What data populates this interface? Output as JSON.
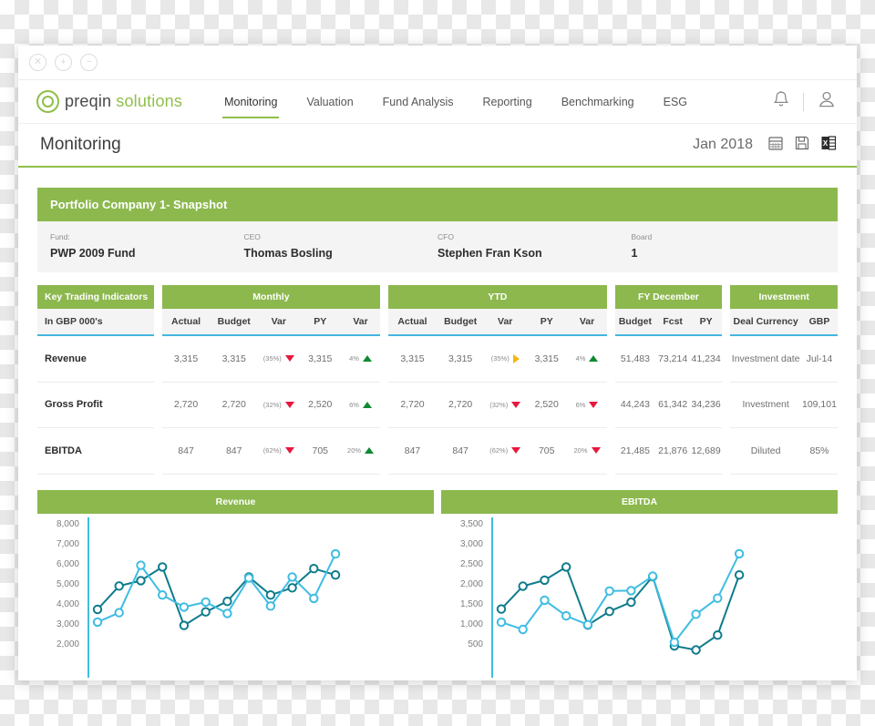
{
  "window": {
    "titlebar_buttons": [
      {
        "name": "close",
        "glyph": "×"
      },
      {
        "name": "maximize",
        "glyph": "+"
      },
      {
        "name": "minimize",
        "glyph": "−"
      }
    ]
  },
  "nav": {
    "brand_primary": "preqin",
    "brand_secondary": "solutions",
    "items": [
      {
        "label": "Monitoring",
        "active": true
      },
      {
        "label": "Valuation",
        "active": false
      },
      {
        "label": "Fund Analysis",
        "active": false
      },
      {
        "label": "Reporting",
        "active": false
      },
      {
        "label": "Benchmarking",
        "active": false
      },
      {
        "label": "ESG",
        "active": false
      }
    ],
    "notification_icon": "bell-icon",
    "account_icon": "user-icon"
  },
  "page_header": {
    "title": "Monitoring",
    "period": "Jan 2018",
    "actions": [
      "calendar-icon",
      "save-icon",
      "excel-export-icon"
    ]
  },
  "snapshot": {
    "title": "Portfolio Company 1- Snapshot",
    "fields": [
      {
        "label": "Fund:",
        "value": "PWP 2009 Fund"
      },
      {
        "label": "CEO",
        "value": "Thomas Bosling"
      },
      {
        "label": "CFO",
        "value": "Stephen Fran Kson"
      },
      {
        "label": "Board",
        "value": "1"
      }
    ]
  },
  "kti": {
    "groups": [
      {
        "head": "Key Trading Indicators",
        "subheads": [
          "In GBP 000's"
        ]
      },
      {
        "head": "Monthly",
        "subheads": [
          "Actual",
          "Budget",
          "Var",
          "PY",
          "Var"
        ]
      },
      {
        "head": "YTD",
        "subheads": [
          "Actual",
          "Budget",
          "Var",
          "PY",
          "Var"
        ]
      },
      {
        "head": "FY December",
        "subheads": [
          "Budget",
          "Fcst",
          "PY"
        ]
      },
      {
        "head": "Investment",
        "subheads": [
          "Deal Currency",
          "GBP"
        ]
      }
    ],
    "rows": [
      {
        "name": "Revenue",
        "monthly": {
          "actual": "3,315",
          "budget": "3,315",
          "var1_pct": "(35%)",
          "var1_dir": "down",
          "py": "3,315",
          "var2_pct": "4%",
          "var2_dir": "up"
        },
        "ytd": {
          "actual": "3,315",
          "budget": "3,315",
          "var1_pct": "(35%)",
          "var1_dir": "flat",
          "py": "3,315",
          "var2_pct": "4%",
          "var2_dir": "up"
        },
        "fy": {
          "budget": "51,483",
          "fcst": "73,214",
          "py": "41,234"
        },
        "investment": {
          "label": "Investment date",
          "value": "Jul-14"
        }
      },
      {
        "name": "Gross Profit",
        "monthly": {
          "actual": "2,720",
          "budget": "2,720",
          "var1_pct": "(32%)",
          "var1_dir": "down",
          "py": "2,520",
          "var2_pct": "6%",
          "var2_dir": "up"
        },
        "ytd": {
          "actual": "2,720",
          "budget": "2,720",
          "var1_pct": "(32%)",
          "var1_dir": "down",
          "py": "2,520",
          "var2_pct": "6%",
          "var2_dir": "down"
        },
        "fy": {
          "budget": "44,243",
          "fcst": "61,342",
          "py": "34,236"
        },
        "investment": {
          "label": "Investment",
          "value": "109,101"
        }
      },
      {
        "name": "EBITDA",
        "monthly": {
          "actual": "847",
          "budget": "847",
          "var1_pct": "(62%)",
          "var1_dir": "down",
          "py": "705",
          "var2_pct": "20%",
          "var2_dir": "up"
        },
        "ytd": {
          "actual": "847",
          "budget": "847",
          "var1_pct": "(62%)",
          "var1_dir": "down",
          "py": "705",
          "var2_pct": "20%",
          "var2_dir": "down"
        },
        "fy": {
          "budget": "21,485",
          "fcst": "21,876",
          "py": "12,689"
        },
        "investment": {
          "label": "Diluted",
          "value": "85%"
        }
      }
    ]
  },
  "chart_data": [
    {
      "type": "line",
      "title": "Revenue",
      "xlabel": "",
      "ylabel": "",
      "ylim": [
        2000,
        8000
      ],
      "yticks": [
        2000,
        3000,
        4000,
        5000,
        6000,
        7000,
        8000
      ],
      "ytick_labels": [
        "2,000",
        "3,000",
        "4,000",
        "5,000",
        "6,000",
        "7,000",
        "8,000"
      ],
      "grid": false,
      "legend": "none",
      "colors": {
        "actual": "#0e7b8c",
        "comparison": "#3fbde2"
      },
      "x": [
        1,
        2,
        3,
        4,
        5,
        6,
        7,
        8,
        9,
        10,
        11,
        12,
        13,
        14,
        15,
        16
      ],
      "series": [
        {
          "name": "Actual",
          "color": "#0e7b8c",
          "values": [
            3680,
            4850,
            5120,
            5800,
            2880,
            3560,
            4080,
            5300,
            4400,
            4760,
            5720,
            5400,
            null,
            null,
            null,
            null
          ]
        },
        {
          "name": "Prior Year",
          "color": "#3fbde2",
          "values": [
            3050,
            3520,
            5880,
            4400,
            3800,
            4050,
            3480,
            5250,
            3850,
            5300,
            4230,
            6450,
            null,
            null,
            null,
            null
          ]
        }
      ]
    },
    {
      "type": "line",
      "title": "EBITDA",
      "xlabel": "",
      "ylabel": "",
      "ylim": [
        500,
        3500
      ],
      "yticks": [
        500,
        1000,
        1500,
        2000,
        2500,
        3000,
        3500
      ],
      "ytick_labels": [
        "500",
        "1,000",
        "1,500",
        "2,000",
        "2,500",
        "3,000",
        "3,500"
      ],
      "grid": false,
      "legend": "none",
      "colors": {
        "actual": "#0e7b8c",
        "comparison": "#3fbde2"
      },
      "x": [
        1,
        2,
        3,
        4,
        5,
        6,
        7,
        8,
        9,
        10,
        11,
        12,
        13,
        14,
        15,
        16
      ],
      "series": [
        {
          "name": "Actual",
          "color": "#0e7b8c",
          "values": [
            1350,
            1920,
            2070,
            2400,
            950,
            1290,
            1520,
            2160,
            430,
            330,
            700,
            2200,
            null,
            null,
            null,
            null
          ]
        },
        {
          "name": "Prior Year",
          "color": "#3fbde2",
          "values": [
            1020,
            840,
            1570,
            1180,
            960,
            1800,
            1810,
            2170,
            520,
            1220,
            1620,
            2730,
            null,
            null,
            null,
            null
          ]
        }
      ]
    }
  ],
  "theme": {
    "green": "#8cb84e",
    "blue_rule": "#45b6e0",
    "dark_line": "#0e7b8c",
    "light_line": "#3fbde2",
    "down_red": "#e8173d",
    "up_green": "#0d8a2f",
    "flat_amber": "#f5b60d"
  }
}
